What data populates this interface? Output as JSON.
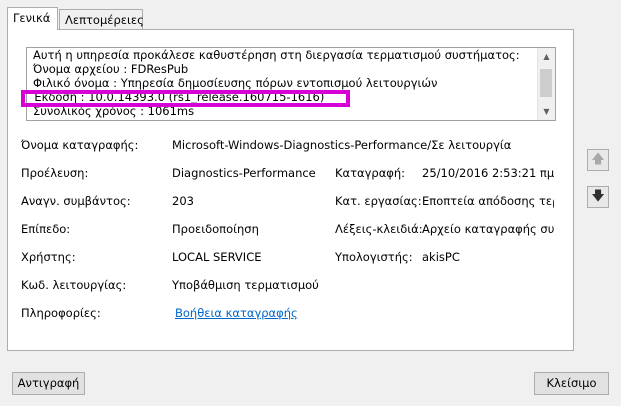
{
  "tabs": [
    {
      "label": "Γενικά"
    },
    {
      "label": "Λεπτομέρειες"
    }
  ],
  "description": {
    "lines": [
      "Αυτή η υπηρεσία προκάλεσε καθυστέρηση στη διεργασία τερματισμού συστήματος:",
      "   Όνομα αρχείου          :            FDResPub",
      "   Φιλικό όνομα            :            Υπηρεσία δημοσίευσης πόρων εντοπισμού λειτουργιών",
      "   Έκδοση                     :            10.0.14393.0 (rs1_release.160715-1616)",
      "   Συνολικός χρόνος      :            1061ms"
    ]
  },
  "fields": {
    "log_name": {
      "label": "Όνομα καταγραφής:",
      "value": "Microsoft-Windows-Diagnostics-Performance/Σε λειτουργία"
    },
    "source": {
      "label": "Προέλευση:",
      "value": "Diagnostics-Performance"
    },
    "logged": {
      "label": "Καταγραφή:",
      "value": "25/10/2016 2:53:21 πμ"
    },
    "event_id": {
      "label": "Αναγν. συμβάντος:",
      "value": "203"
    },
    "task_category": {
      "label": "Κατ. εργασίας:",
      "value": "Εποπτεία απόδοσης τερ"
    },
    "level": {
      "label": "Επίπεδο:",
      "value": "Προειδοποίηση"
    },
    "keywords": {
      "label": "Λέξεις-κλειδιά:",
      "value": "Αρχείο καταγραφής συμ"
    },
    "user": {
      "label": "Χρήστης:",
      "value": "LOCAL SERVICE"
    },
    "computer": {
      "label": "Υπολογιστής:",
      "value": "akisPC"
    },
    "opcode": {
      "label": "Κωδ. λειτουργίας:",
      "value": "Υποβάθμιση τερματισμού"
    },
    "more_info": {
      "label": "Πληροφορίες:",
      "value": "Βοήθεια καταγραφής"
    }
  },
  "buttons": {
    "copy": "Αντιγραφή",
    "close": "Κλείσιμο"
  },
  "icons": {
    "scroll_up": "scroll-up-arrow",
    "scroll_down": "scroll-down-arrow",
    "prev": "up-arrow",
    "next": "down-arrow"
  },
  "colors": {
    "highlight": "#d600d6",
    "link": "#0066cc"
  }
}
